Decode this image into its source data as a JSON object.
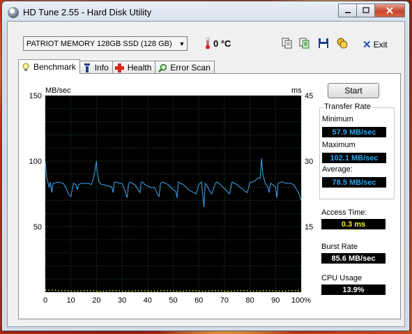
{
  "window": {
    "title": "HD Tune 2.55 - Hard Disk Utility"
  },
  "toolbar": {
    "drive": "PATRIOT MEMORY 128GB SSD (128 GB)",
    "temperature": "0 °C",
    "exit_label": "Exit"
  },
  "tabs": [
    {
      "label": "Benchmark",
      "icon": "lightbulb-icon"
    },
    {
      "label": "Info",
      "icon": "info-icon"
    },
    {
      "label": "Health",
      "icon": "health-cross-icon"
    },
    {
      "label": "Error Scan",
      "icon": "magnifier-icon"
    }
  ],
  "benchmark": {
    "start_label": "Start",
    "transfer_rate_title": "Transfer Rate",
    "minimum_label": "Minimum",
    "minimum_value": "57.9 MB/sec",
    "maximum_label": "Maximum",
    "maximum_value": "102.1 MB/sec",
    "average_label": "Average:",
    "average_value": "78.5 MB/sec",
    "access_time_label": "Access Time:",
    "access_time_value": "0.3 ms",
    "burst_rate_label": "Burst Rate",
    "burst_rate_value": "85.6 MB/sec",
    "cpu_usage_label": "CPU Usage",
    "cpu_usage_value": "13.9%"
  },
  "colors": {
    "transfer_line": "#3fa9f5",
    "access_points": "#f3f32a",
    "graph_bg": "#000000",
    "grid": "#1f5a2a"
  },
  "chart_data": {
    "type": "line",
    "ylabel": "MB/sec",
    "y2label": "ms",
    "ylim": [
      0,
      150
    ],
    "y2lim": [
      0,
      45
    ],
    "yticks": [
      "150",
      "100",
      "50"
    ],
    "y2ticks": [
      "45",
      "30",
      "15"
    ],
    "xticks": [
      "0",
      "10",
      "20",
      "30",
      "40",
      "50",
      "60",
      "70",
      "80",
      "90",
      "100%"
    ],
    "xlim": [
      0,
      100
    ],
    "grid": true,
    "series": [
      {
        "name": "transfer",
        "x": [
          0,
          0.5,
          1.5,
          2,
          2.5,
          3,
          5,
          7,
          8,
          9,
          10,
          11,
          12,
          12.5,
          13,
          14,
          15,
          17,
          18,
          19,
          20,
          20.2,
          21,
          21.5,
          22,
          23,
          24,
          25,
          26,
          26.5,
          27,
          28,
          29,
          30,
          31,
          32,
          32.5,
          33,
          34,
          35,
          36,
          37,
          37.5,
          38,
          39,
          40,
          41,
          42,
          43,
          44,
          44.5,
          45,
          46,
          47,
          48,
          49,
          50,
          51,
          51.5,
          52,
          53,
          54,
          55,
          56,
          57,
          58,
          59,
          60,
          61,
          61.5,
          62,
          62.5,
          63,
          64,
          65,
          66,
          66.5,
          67,
          68,
          69,
          70,
          71,
          72,
          73,
          74,
          75,
          76,
          77,
          78,
          79,
          80,
          81,
          82,
          83,
          84,
          84.5,
          85,
          86,
          87,
          87.5,
          88,
          89,
          90,
          90.5,
          91,
          92,
          93,
          94,
          95,
          96,
          97,
          98,
          99,
          100
        ],
        "values": [
          100,
          88,
          80,
          84,
          76,
          83,
          84,
          83,
          80,
          75,
          73,
          83,
          82,
          78,
          82,
          83,
          83,
          83,
          82,
          88,
          100,
          93,
          84,
          83,
          82,
          82,
          81,
          81,
          80,
          76,
          84,
          84,
          83,
          83,
          78,
          72,
          82,
          84,
          83,
          82,
          79,
          76,
          84,
          84,
          82,
          81,
          80,
          80,
          79,
          74,
          73,
          83,
          84,
          83,
          82,
          80,
          78,
          77,
          72,
          84,
          83,
          82,
          80,
          78,
          77,
          76,
          75,
          82,
          84,
          75,
          65,
          83,
          82,
          78,
          75,
          80,
          83,
          84,
          83,
          81,
          79,
          77,
          75,
          84,
          83,
          82,
          80,
          79,
          77,
          76,
          84,
          84,
          85,
          87,
          87,
          102,
          90,
          83,
          80,
          76,
          83,
          82,
          80,
          72,
          83,
          84,
          84,
          83,
          83,
          83,
          82,
          79,
          76,
          70
        ]
      },
      {
        "name": "access",
        "x": [
          0,
          5,
          10,
          15,
          20,
          25,
          30,
          35,
          40,
          45,
          50,
          55,
          60,
          65,
          70,
          75,
          80,
          85,
          90,
          95,
          100
        ],
        "values": [
          0.4,
          0.3,
          0.2,
          0.3,
          0.2,
          0.3,
          0.2,
          0.3,
          0.2,
          0.3,
          0.2,
          0.3,
          0.2,
          0.3,
          0.2,
          0.3,
          0.2,
          0.3,
          0.2,
          0.3,
          0.2
        ]
      }
    ]
  }
}
